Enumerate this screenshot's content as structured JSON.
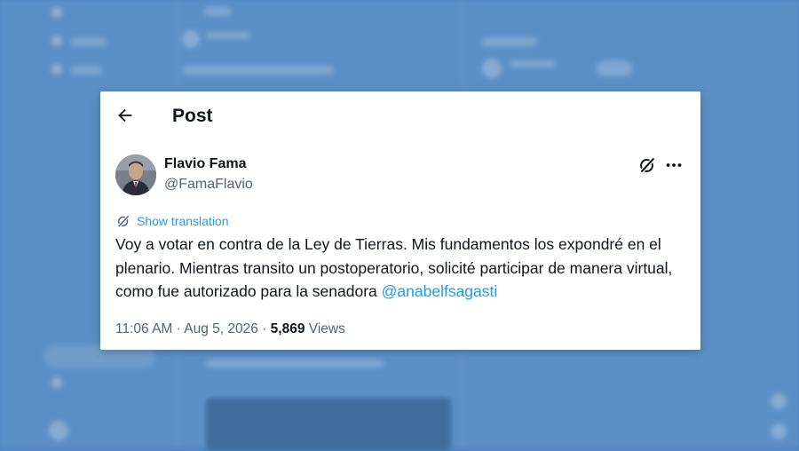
{
  "header": {
    "title": "Post"
  },
  "author": {
    "display_name": "Flavio Fama",
    "handle": "@FamaFlavio"
  },
  "translation": {
    "label": "Show translation"
  },
  "post": {
    "text": "Voy a votar en contra de la Ley de Tierras. Mis fundamentos los expondré en el plenario. Mientras transito un postoperatorio, solicité participar de manera virtual, como fue autorizado para la senadora ",
    "mention": "@anabelfsagasti"
  },
  "meta": {
    "time": "11:06 AM",
    "separator": " · ",
    "date": "Aug 5, 2026",
    "views_count": "5,869",
    "views_label": " Views"
  },
  "icons": {
    "back": "back-arrow-icon",
    "grok": "grok-icon",
    "more": "more-dots-icon",
    "translate": "translate-icon"
  },
  "colors": {
    "background": "#4f86c0",
    "card": "#ffffff",
    "text": "#0f1419",
    "muted": "#536471",
    "link": "#1d9bf0"
  }
}
